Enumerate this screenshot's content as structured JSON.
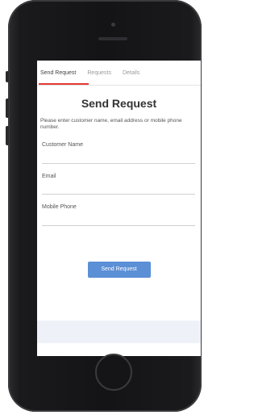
{
  "tabs": [
    {
      "label": "Send Request"
    },
    {
      "label": "Requests"
    },
    {
      "label": "Details"
    }
  ],
  "page_title": "Send Request",
  "instructions": "Please enter customer name, email address or mobile phone number.",
  "fields": {
    "customer_name": {
      "label": "Customer Name",
      "value": ""
    },
    "email": {
      "label": "Email",
      "value": ""
    },
    "mobile_phone": {
      "label": "Mobile Phone",
      "value": ""
    }
  },
  "submit_label": "Send Request",
  "colors": {
    "accent": "#e53935",
    "button": "#5b8fd6",
    "footer": "#eef2f8"
  }
}
